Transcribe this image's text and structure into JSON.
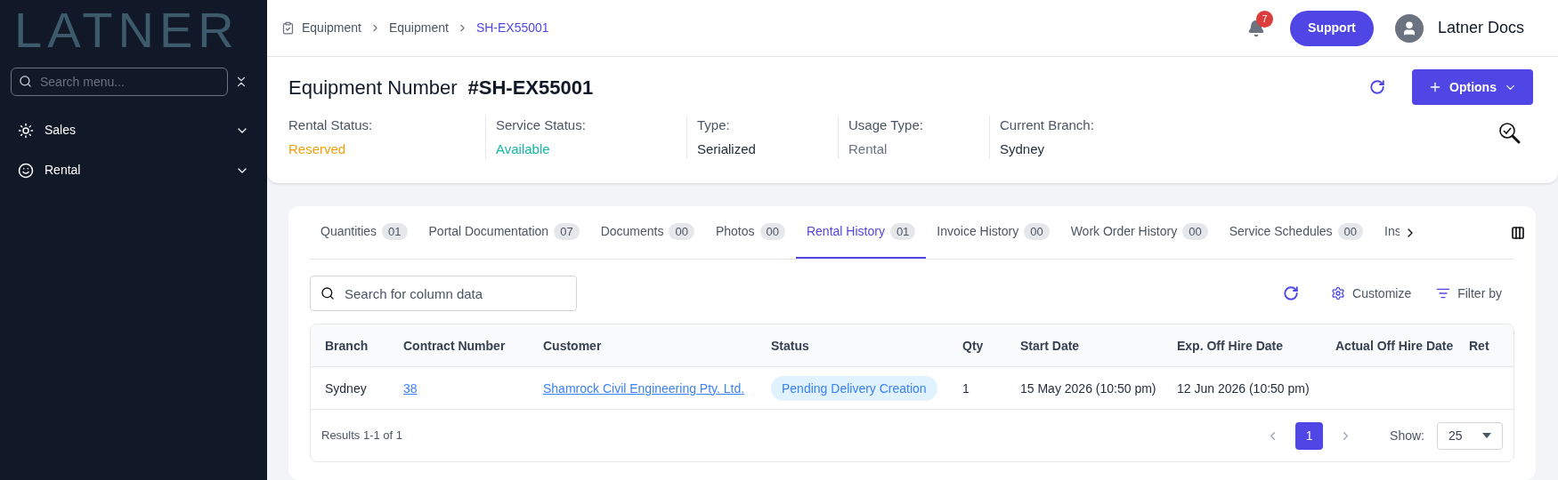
{
  "sidebar": {
    "logo": "LATNER",
    "search": {
      "placeholder": "Search menu..."
    },
    "items": [
      {
        "label": "Sales",
        "kind": "sales",
        "expanded": false
      },
      {
        "label": "Rental",
        "kind": "rental",
        "expanded": false
      }
    ]
  },
  "breadcrumbs": [
    {
      "label": "Equipment",
      "current": false
    },
    {
      "label": "Equipment",
      "current": false
    },
    {
      "label": "SH-EX55001",
      "current": true
    }
  ],
  "header": {
    "notification_count": "7",
    "support": "Support",
    "user": "Latner Docs"
  },
  "equipment": {
    "label": "Equipment Number",
    "number": "#SH-EX55001",
    "options": "Options",
    "fields": [
      {
        "label": "Rental Status:",
        "value": "Reserved",
        "color": "#f59e0b"
      },
      {
        "label": "Service Status:",
        "value": "Available",
        "color": "#14b8a6"
      },
      {
        "label": "Type:",
        "value": "Serialized",
        "color": "#1f2937"
      },
      {
        "label": "Usage Type:",
        "value": "Rental",
        "color": "#6b7280"
      },
      {
        "label": "Current Branch:",
        "value": "Sydney",
        "color": "#1f2937"
      }
    ]
  },
  "tabs": [
    {
      "label": "Quantities",
      "count": "01",
      "selected": false
    },
    {
      "label": "Portal Documentation",
      "count": "07",
      "selected": false
    },
    {
      "label": "Documents",
      "count": "00",
      "selected": false
    },
    {
      "label": "Photos",
      "count": "00",
      "selected": false
    },
    {
      "label": "Rental History",
      "count": "01",
      "selected": true
    },
    {
      "label": "Invoice History",
      "count": "00",
      "selected": false
    },
    {
      "label": "Work Order History",
      "count": "00",
      "selected": false
    },
    {
      "label": "Service Schedules",
      "count": "00",
      "selected": false
    },
    {
      "label": "Ins",
      "selected": false
    }
  ],
  "toolbar": {
    "search": {
      "placeholder": "Search for column data"
    },
    "customize": "Customize",
    "filter": "Filter by"
  },
  "table": {
    "columns": [
      "Branch",
      "Contract Number",
      "Customer",
      "Status",
      "Qty",
      "Start Date",
      "Exp. Off Hire Date",
      "Actual Off Hire Date",
      "Ret"
    ],
    "rows": [
      [
        {
          "kind": "text",
          "text": "Sydney"
        },
        {
          "kind": "link",
          "text": "38"
        },
        {
          "kind": "link",
          "text": "Shamrock Civil Engineering Pty. Ltd."
        },
        {
          "kind": "badge",
          "text": "Pending Delivery Creation"
        },
        {
          "kind": "text",
          "text": "1"
        },
        {
          "kind": "text",
          "text": "15 May 2026 (10:50 pm)"
        },
        {
          "kind": "text",
          "text": "12 Jun 2026 (10:50 pm)"
        }
      ]
    ]
  },
  "footer": {
    "results": "Results 1-1 of 1",
    "pages": [
      {
        "label": "1",
        "selected": true
      }
    ],
    "show_label": "Show:",
    "page_size": "25"
  }
}
